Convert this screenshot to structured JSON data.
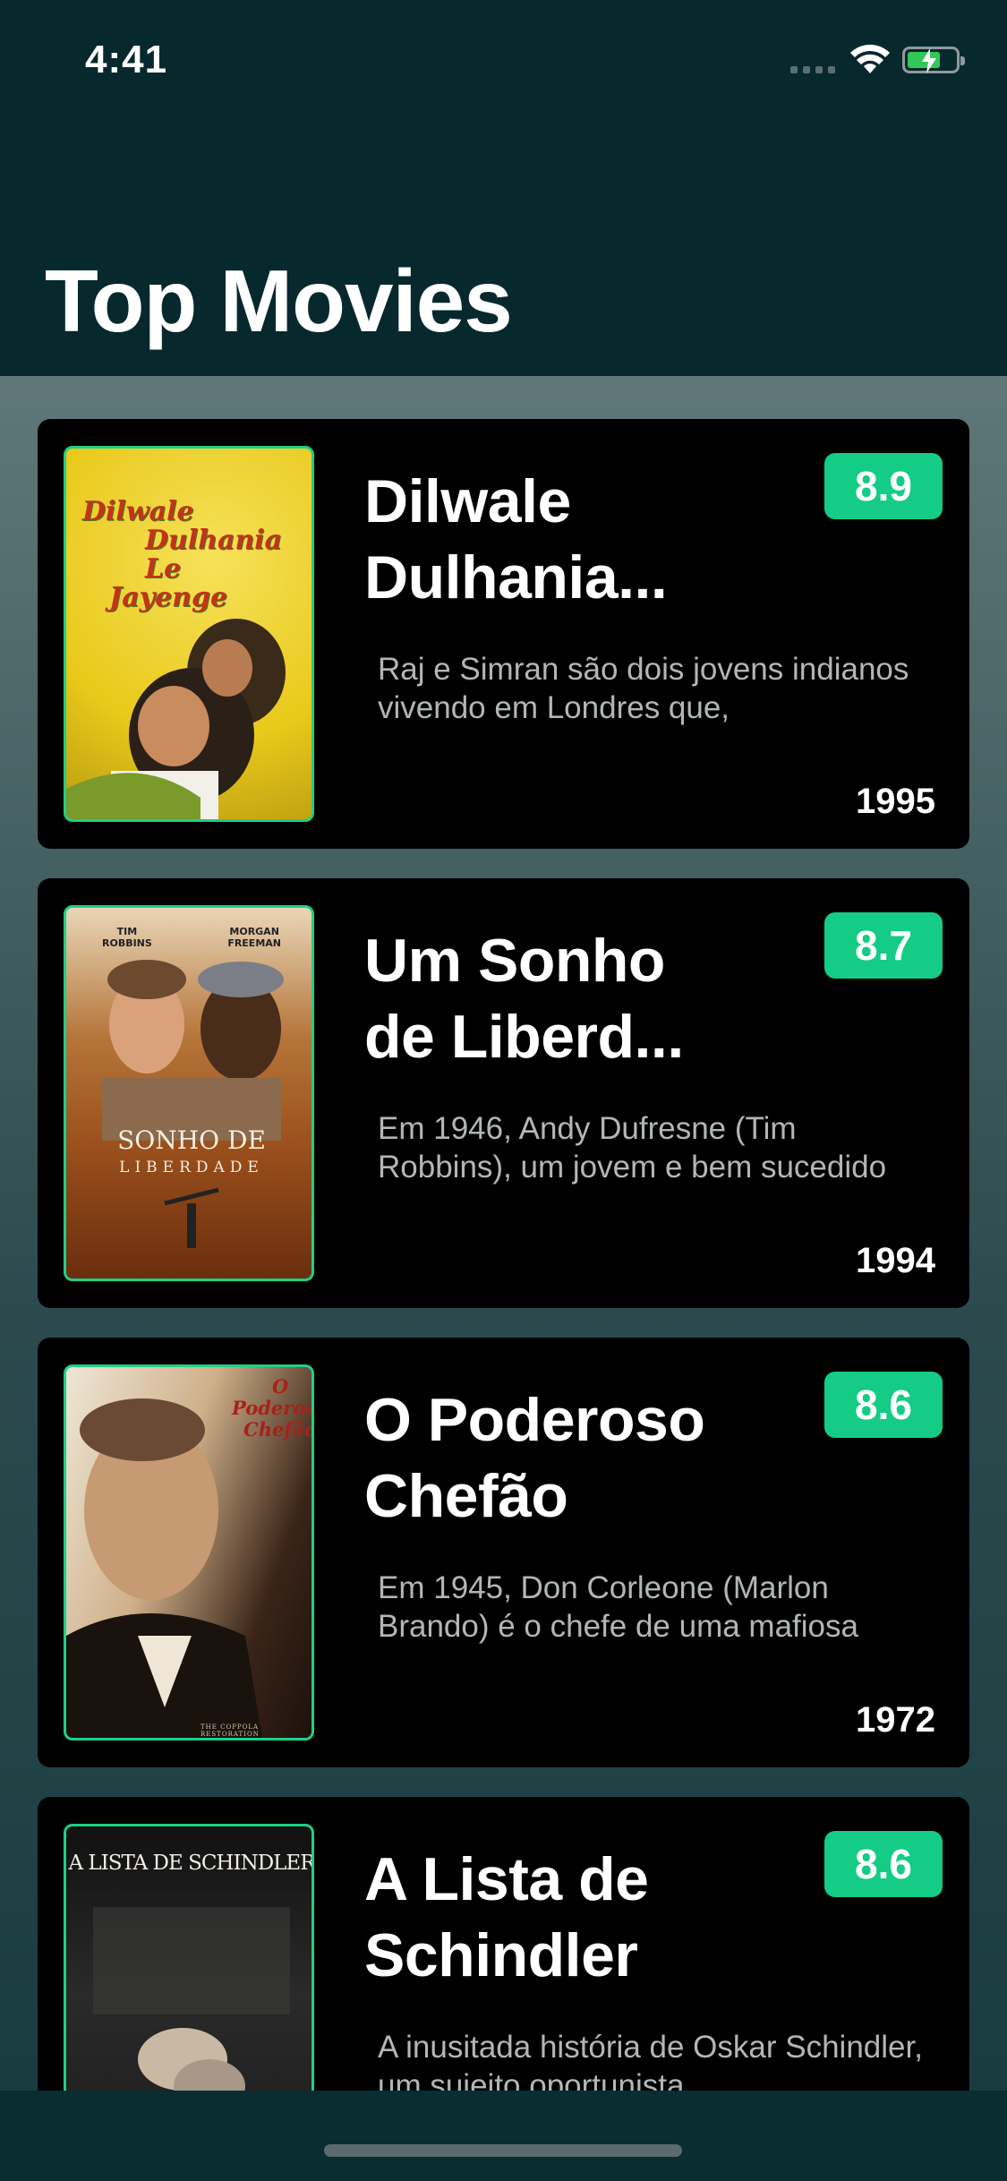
{
  "status_bar": {
    "time": "4:41"
  },
  "header": {
    "title": "Top Movies"
  },
  "colors": {
    "accent": "#14cc86",
    "header_bg": "#07292d",
    "card_bg": "#000000"
  },
  "movies": [
    {
      "title": "Dilwale Dulhania...",
      "rating": "8.9",
      "overview": "Raj e Simran são dois jovens indianos vivendo em Londres que,",
      "year": "1995",
      "poster": {
        "lines": [
          "Dilwale",
          "Dulhania",
          "Le",
          "Jayenge"
        ]
      }
    },
    {
      "title": "Um Sonho de Liberd...",
      "rating": "8.7",
      "overview": "Em 1946, Andy Dufresne (Tim Robbins), um jovem e bem sucedido",
      "year": "1994",
      "poster": {
        "actor_left": "TIM\nROBBINS",
        "actor_right": "MORGAN\nFREEMAN",
        "lines": [
          "SONHO DE",
          "LIBERDADE"
        ]
      }
    },
    {
      "title": "O Poderoso Chefão",
      "rating": "8.6",
      "overview": "Em 1945, Don Corleone (Marlon Brando) é o chefe de uma mafiosa",
      "year": "1972",
      "poster": {
        "lines": [
          "O",
          "Poderoso",
          "Chefão"
        ],
        "footer": "THE COPPOLA RESTORATION"
      }
    },
    {
      "title": "A Lista de Schindler",
      "rating": "8.6",
      "overview": "A inusitada história de Oskar Schindler, um sujeito oportunista",
      "year": "",
      "poster": {
        "lines": [
          "A LISTA DE SCHINDLER"
        ]
      }
    }
  ]
}
